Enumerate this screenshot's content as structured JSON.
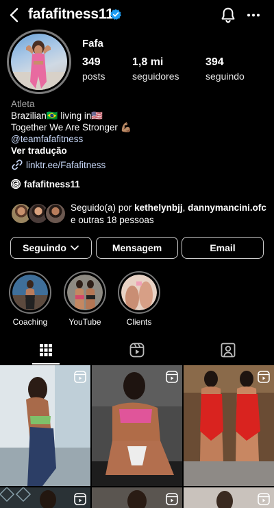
{
  "header": {
    "username": "fafafitness11",
    "icons": {
      "back": "back-arrow-icon",
      "verified": "verified-badge-icon",
      "notifications": "bell-icon",
      "more": "more-horizontal-icon"
    }
  },
  "profile": {
    "display_name": "Fafa",
    "stats": [
      {
        "value": "349",
        "label": "posts"
      },
      {
        "value": "1,8 mi",
        "label": "seguidores"
      },
      {
        "value": "394",
        "label": "seguindo"
      }
    ],
    "category": "Atleta",
    "bio_line_1": "Brazilian🇧🇷 living in🇺🇸",
    "bio_line_2": "Together We Are Stronger 💪🏽",
    "mention": "@teamfafafitness",
    "translate": "Ver tradução",
    "link": "linktr.ee/Fafafitness",
    "threads_handle": "fafafitness11"
  },
  "followed_by": {
    "prefix": "Seguido(a) por ",
    "name_1": "kethelynbjj",
    "separator": ",",
    "name_2": "dannymancini.ofc",
    "suffix": " e outras 18 pessoas"
  },
  "actions": {
    "following": "Seguindo",
    "message": "Mensagem",
    "email": "Email"
  },
  "highlights": [
    {
      "label": "Coaching"
    },
    {
      "label": "YouTube"
    },
    {
      "label": "Clients"
    }
  ],
  "tabs": [
    "grid-icon",
    "reels-icon",
    "tagged-icon"
  ],
  "colors": {
    "background": "#000000",
    "link": "#c8d8f8",
    "verified": "#1d9bf0",
    "secondary_text": "#a8a8a8",
    "border": "#cfcfcf"
  }
}
